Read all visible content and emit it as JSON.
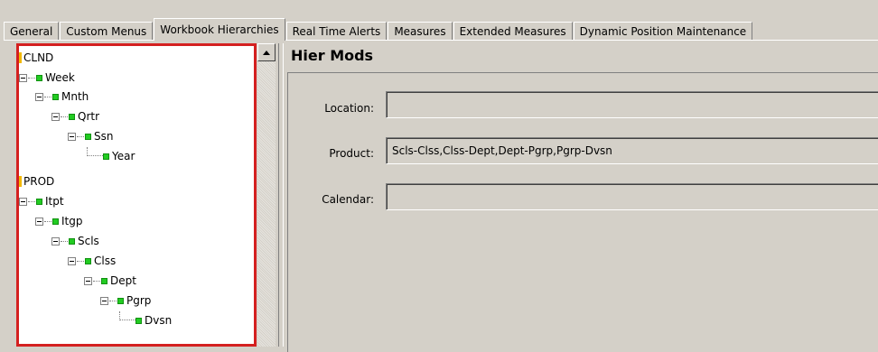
{
  "tabs": [
    {
      "label": "General",
      "active": false
    },
    {
      "label": "Custom Menus",
      "active": false
    },
    {
      "label": "Workbook Hierarchies",
      "active": true
    },
    {
      "label": "Real Time Alerts",
      "active": false
    },
    {
      "label": "Measures",
      "active": false
    },
    {
      "label": "Extended Measures",
      "active": false
    },
    {
      "label": "Dynamic Position Maintenance",
      "active": false
    }
  ],
  "tree": {
    "roots": [
      {
        "label": "CLND",
        "path": [
          "Week",
          "Mnth",
          "Qrtr",
          "Ssn",
          "Year"
        ]
      },
      {
        "label": "PROD",
        "path": [
          "Itpt",
          "Itgp",
          "Scls",
          "Clss",
          "Dept",
          "Pgrp",
          "Dvsn"
        ]
      }
    ]
  },
  "panel": {
    "title": "Hier Mods",
    "fields": [
      {
        "label": "Location:",
        "value": ""
      },
      {
        "label": "Product:",
        "value": "Scls-Clss,Clss-Dept,Dept-Pgrp,Pgrp-Dvsn"
      },
      {
        "label": "Calendar:",
        "value": ""
      }
    ]
  },
  "colors": {
    "window_bg": "#d4d0c8",
    "highlight_border": "#d42020",
    "node_icon": "#22cc22",
    "root_marker": "#f2b800"
  }
}
